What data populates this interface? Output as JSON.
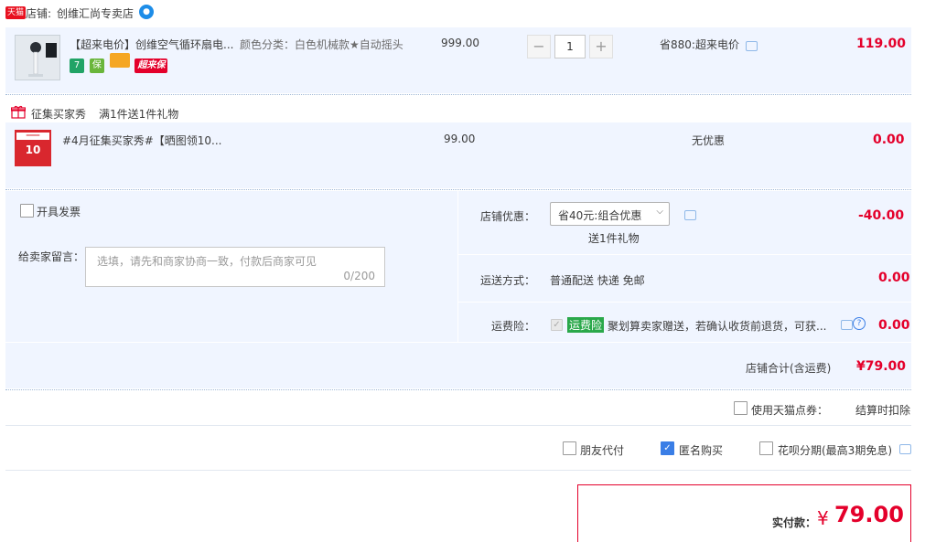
{
  "shop": {
    "tag": "天猫",
    "label": "店铺:",
    "name": "创维汇尚专卖店",
    "ww_icon": "chat-bubble-icon"
  },
  "item": {
    "title": "【超来电价】创维空气循环扇电...",
    "sku": "颜色分类：白色机械款★自动摇头",
    "unit_price": "999.00",
    "quantity": "1",
    "promo": "省880:超来电价",
    "subtotal": "119.00",
    "badges": [
      "7",
      "保",
      "",
      "超来保"
    ]
  },
  "gift_section": {
    "title": "征集买家秀",
    "rule": "满1件送1件礼物"
  },
  "gift_item": {
    "title": "#4月征集买家秀#【晒图领10...",
    "unit_price": "99.00",
    "promo": "无优惠",
    "subtotal": "0.00",
    "thumb_text": "10"
  },
  "order": {
    "invoice_label": "开具发票",
    "message_label": "给卖家留言：",
    "message_placeholder": "选填，请先和商家协商一致，付款后商家可见",
    "message_count": "0/200",
    "shop_discount_label": "店铺优惠：",
    "shop_discount_value": "省40元:组合优惠",
    "shop_discount_sub": "送1件礼物",
    "shop_discount_amount": "-40.00",
    "delivery_label": "运送方式：",
    "delivery_value": "普通配送 快递 免邮",
    "delivery_amount": "0.00",
    "insurance_label": "运费险：",
    "insurance_tag": "运费险",
    "insurance_text": "聚划算卖家赠送，若确认收货前退货，可获...",
    "insurance_amount": "0.00",
    "shop_total_label": "店铺合计(含运费)",
    "shop_total_value": "¥79.00"
  },
  "points": {
    "label": "使用天猫点券：",
    "value": "结算时扣除"
  },
  "options": {
    "friend_pay": "朋友代付",
    "anonymous": "匿名购买",
    "huabei": "花呗分期(最高3期免息)"
  },
  "payment": {
    "label": "实付款：",
    "currency": "¥",
    "amount": "79.00"
  },
  "colors": {
    "price_red": "#e4002b",
    "section_bg": "#f0f5ff",
    "accent_blue": "#3a7ee6",
    "freight_green": "#2aa84a"
  }
}
